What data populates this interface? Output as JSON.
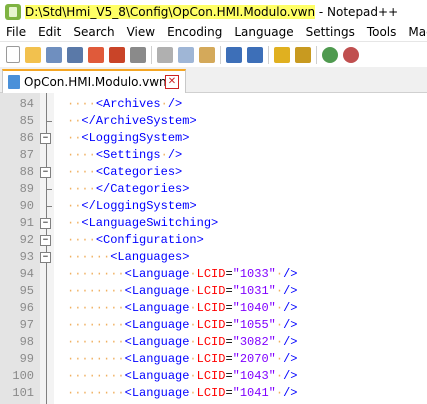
{
  "title": {
    "path": "D:\\Std\\Hmi_V5_8\\Config\\OpCon.HMI.Modulo.vwn",
    "suffix": " - Notepad++"
  },
  "menu": [
    "File",
    "Edit",
    "Search",
    "View",
    "Encoding",
    "Language",
    "Settings",
    "Tools",
    "Macro"
  ],
  "toolbar": {
    "icons": [
      "new-file-icon",
      "open-file-icon",
      "save-icon",
      "save-all-icon",
      "close-icon",
      "close-all-icon",
      "print-icon",
      "cut-icon",
      "copy-icon",
      "paste-icon",
      "undo-icon",
      "redo-icon",
      "find-icon",
      "replace-icon",
      "zoom-in-icon",
      "zoom-out-icon"
    ]
  },
  "tab": {
    "label": "OpCon.HMI.Modulo.vwn",
    "close": "✕"
  },
  "editor": {
    "lines": [
      {
        "no": "84",
        "indent": 4,
        "text": "<Archives />"
      },
      {
        "no": "85",
        "indent": 2,
        "text": "</ArchiveSystem>"
      },
      {
        "no": "86",
        "indent": 2,
        "text": "<LoggingSystem>"
      },
      {
        "no": "87",
        "indent": 4,
        "text": "<Settings />"
      },
      {
        "no": "88",
        "indent": 4,
        "text": "<Categories>"
      },
      {
        "no": "89",
        "indent": 4,
        "text": "</Categories>"
      },
      {
        "no": "90",
        "indent": 2,
        "text": "</LoggingSystem>"
      },
      {
        "no": "91",
        "indent": 2,
        "text": "<LanguageSwitching>"
      },
      {
        "no": "92",
        "indent": 4,
        "text": "<Configuration>"
      },
      {
        "no": "93",
        "indent": 6,
        "text": "<Languages>"
      },
      {
        "no": "94",
        "indent": 8,
        "text": "<Language LCID=\"1033\" />"
      },
      {
        "no": "95",
        "indent": 8,
        "text": "<Language LCID=\"1031\" />"
      },
      {
        "no": "96",
        "indent": 8,
        "text": "<Language LCID=\"1040\" />"
      },
      {
        "no": "97",
        "indent": 8,
        "text": "<Language LCID=\"1055\" />"
      },
      {
        "no": "98",
        "indent": 8,
        "text": "<Language LCID=\"3082\" />"
      },
      {
        "no": "99",
        "indent": 8,
        "text": "<Language LCID=\"2070\" />"
      },
      {
        "no": "100",
        "indent": 8,
        "text": "<Language LCID=\"1043\" />"
      },
      {
        "no": "101",
        "indent": 8,
        "text": "<Language LCID=\"1041\" />"
      }
    ]
  }
}
